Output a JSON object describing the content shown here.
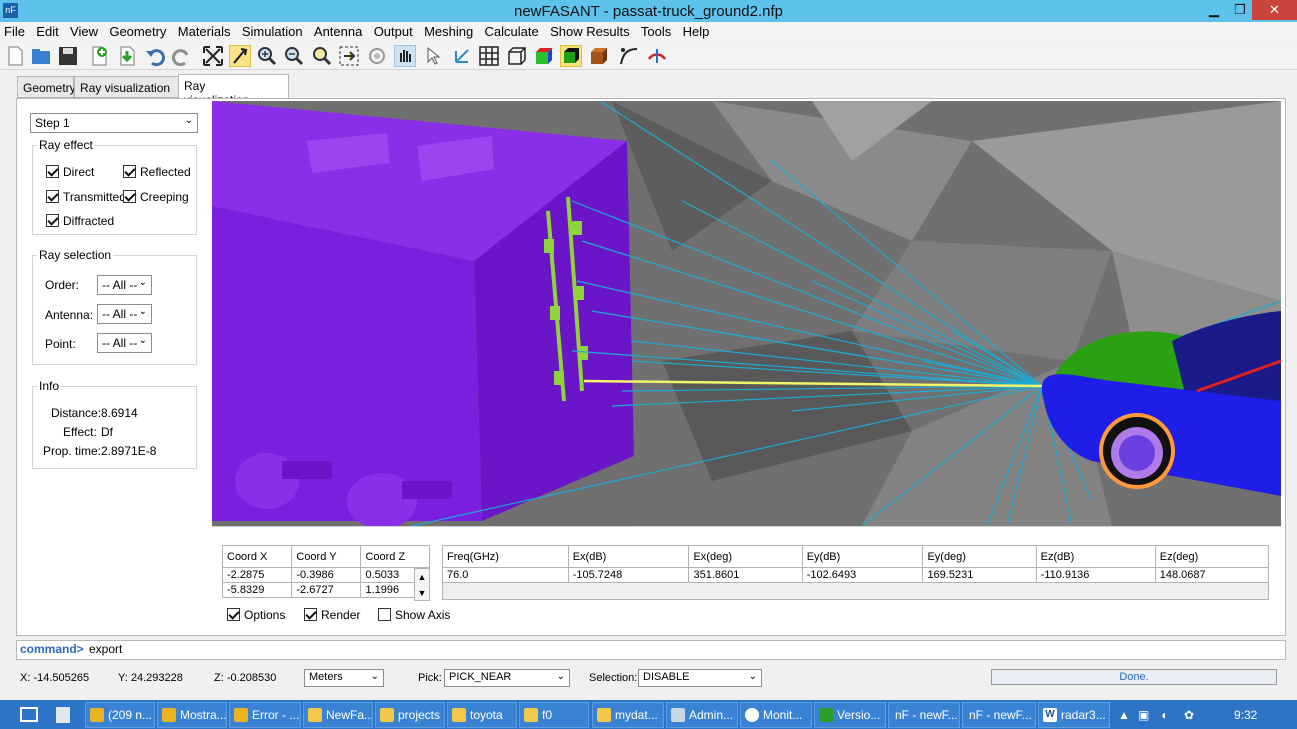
{
  "window": {
    "title": "newFASANT - passat-truck_ground2.nfp",
    "app_icon": "nF",
    "minimize": "▁",
    "maximize": "❐",
    "close": "✕"
  },
  "menu": [
    "File",
    "Edit",
    "View",
    "Geometry",
    "Materials",
    "Simulation",
    "Antenna",
    "Output",
    "Meshing",
    "Calculate",
    "Show Results",
    "Tools",
    "Help"
  ],
  "toolbar_icons": [
    "new-file-icon",
    "open-folder-icon",
    "save-icon",
    "add-icon",
    "import-icon",
    "undo-icon",
    "redo-icon",
    "fit-view-icon",
    "select-arrow-icon",
    "zoom-in-icon",
    "zoom-out-icon",
    "zoom-box-icon",
    "zoom-selection-icon",
    "rotate-icon",
    "pan-hand-icon",
    "pointer-icon",
    "axis-icon",
    "grid-icon",
    "wireframe-box-icon",
    "solid-box-icon",
    "shaded-box-icon",
    "textured-box-icon",
    "ray-icon",
    "antenna-icon"
  ],
  "tabs": {
    "geometry": "Geometry",
    "ray1": "Ray visualization",
    "ray2": "Ray visualization",
    "close": "×"
  },
  "side": {
    "step_value": "Step 1",
    "ray_effect_title": "Ray effect",
    "direct": "Direct",
    "reflected": "Reflected",
    "transmitted": "Transmitted",
    "creeping": "Creeping",
    "diffracted": "Diffracted",
    "ray_selection_title": "Ray selection",
    "order_label": "Order:",
    "order_value": "-- All --",
    "antenna_label": "Antenna:",
    "antenna_value": "-- All --",
    "point_label": "Point:",
    "point_value": "-- All --",
    "info_title": "Info",
    "distance_label": "Distance:",
    "distance_value": "8.6914",
    "effect_label": "Effect:",
    "effect_value": "Df",
    "prop_label": "Prop. time:",
    "prop_value": "2.8971E-8"
  },
  "coords": {
    "headers": [
      "Coord X",
      "Coord Y",
      "Coord Z"
    ],
    "rows": [
      [
        "-2.2875",
        "-0.3986",
        "0.5033"
      ],
      [
        "-5.8329",
        "-2.6727",
        "1.1996"
      ]
    ]
  },
  "fields": {
    "headers": [
      "Freq(GHz)",
      "Ex(dB)",
      "Ex(deg)",
      "Ey(dB)",
      "Ey(deg)",
      "Ez(dB)",
      "Ez(deg)"
    ],
    "rows": [
      [
        "76.0",
        "-105.7248",
        "351.8601",
        "-102.6493",
        "169.5231",
        "-110.9136",
        "148.0687"
      ]
    ]
  },
  "options": {
    "options": "Options",
    "render": "Render",
    "show_axis": "Show Axis"
  },
  "command": {
    "prompt": "command>",
    "text": "export"
  },
  "status": {
    "x": "X:  -14.505265",
    "y": "Y:  24.293228",
    "z": "Z:  -0.208530",
    "units": "Meters",
    "pick_label": "Pick:",
    "pick_value": "PICK_NEAR",
    "selection_label": "Selection:",
    "selection_value": "DISABLE",
    "progress": "Done."
  },
  "taskbar": {
    "items": [
      "(209 n...",
      "Mostra...",
      "Error - ...",
      "NewFa...",
      "projects",
      "toyota",
      "f0",
      "mydat...",
      "Admin...",
      "Monit...",
      "Versio...",
      "nF - newF...",
      "nF - newF...",
      "radar3..."
    ],
    "clock": "9:32"
  },
  "colors": {
    "truck": "#7a1fe0",
    "car_body": "#1e1ee8",
    "car_hood": "#2aa012",
    "rays": "#1eaad2",
    "highlight_ray": "#f4f46a",
    "ground": "#6b6b6b"
  }
}
